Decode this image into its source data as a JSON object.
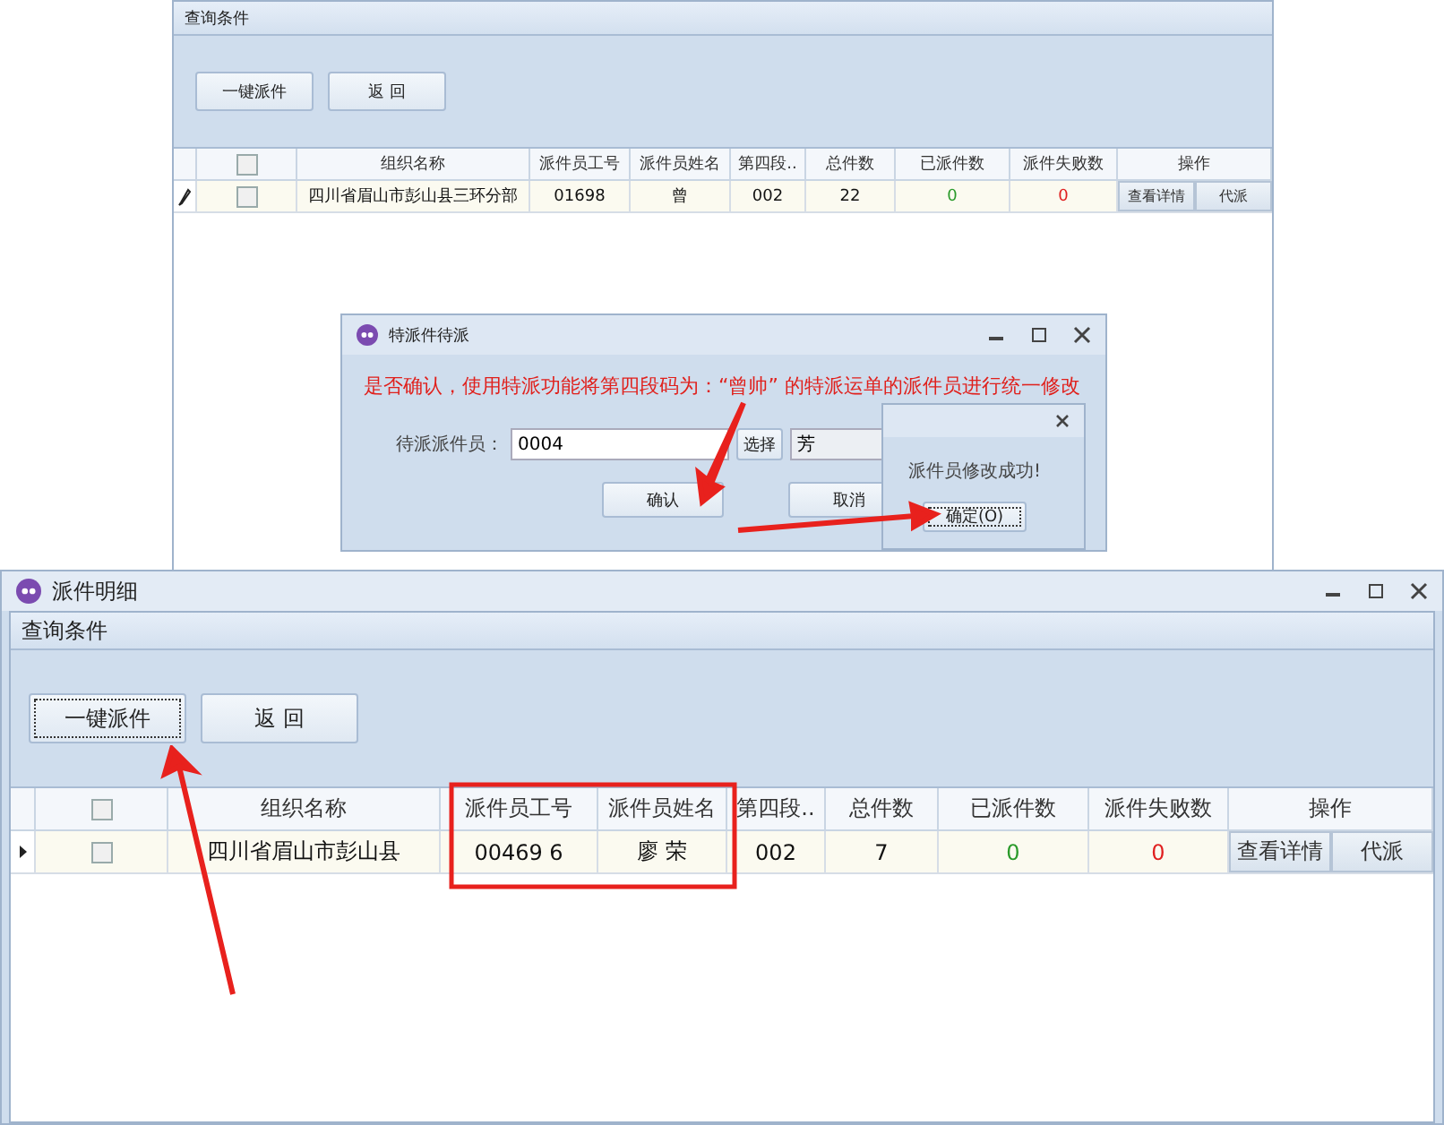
{
  "back_window": {
    "section_title": "查询条件",
    "buttons": [
      "一键派件",
      "返 回"
    ],
    "table": {
      "header_checked": false,
      "columns": [
        "组织名称",
        "派件员工号",
        "派件员姓名",
        "第四段..",
        "总件数",
        "已派件数",
        "派件失败数",
        "操作"
      ],
      "rows": [
        {
          "checked": false,
          "cells": [
            "四川省眉山市彭山县三环分部",
            "01698",
            "曾",
            "002",
            "22",
            "0",
            "0"
          ],
          "actions": [
            "查看详情",
            "代派"
          ]
        }
      ]
    }
  },
  "dialog": {
    "title": "特派件待派",
    "message": "是否确认，使用特派功能将第四段码为：“曾帅” 的特派运单的派件员进行统一修改",
    "field_label": "待派派件员：",
    "field_value": "0004",
    "select_button": "选择",
    "name_value": "芳",
    "buttons": [
      "确认",
      "取消"
    ]
  },
  "message_box": {
    "message": "派件员修改成功!",
    "ok_button": "确定(O)"
  },
  "main_window": {
    "title": "派件明细",
    "section_title": "查询条件",
    "buttons": [
      {
        "label": "一键派件",
        "focused": true
      },
      {
        "label": "返 回",
        "focused": false
      }
    ],
    "table": {
      "header_checked": false,
      "columns": [
        "组织名称",
        "派件员工号",
        "派件员姓名",
        "第四段..",
        "总件数",
        "已派件数",
        "派件失败数",
        "操作"
      ],
      "rows": [
        {
          "checked": false,
          "cells": [
            "四川省眉山市彭山县",
            "00469 6",
            "廖 荣",
            "002",
            "7",
            "0",
            "0"
          ],
          "actions": [
            "查看详情",
            "代派"
          ]
        }
      ]
    }
  }
}
